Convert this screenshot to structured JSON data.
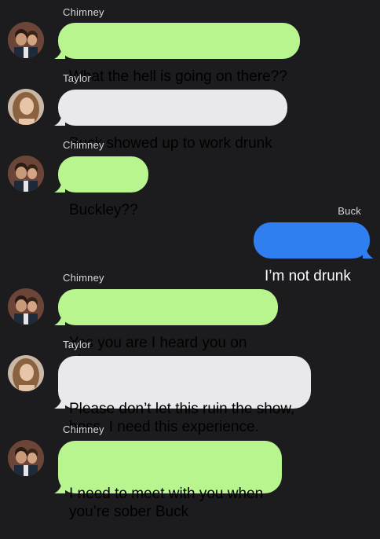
{
  "colors": {
    "background": "#1c1c1e",
    "green_bubble": "#b8f58e",
    "gray_bubble": "#e9e9eb",
    "blue_bubble": "#2f7ff0",
    "sender_name": "#d8d8dc"
  },
  "messages": [
    {
      "sender": "Chimney",
      "text": "What the hell is going on there??",
      "bubble": "green",
      "avatar": "chimney-avatar"
    },
    {
      "sender": "Taylor",
      "text": "Buck showed up to work drunk",
      "bubble": "gray",
      "avatar": "taylor-avatar"
    },
    {
      "sender": "Chimney",
      "text": "Buckley??",
      "bubble": "green",
      "avatar": "chimney-avatar"
    },
    {
      "sender": "Buck",
      "text": "I’m not drunk",
      "bubble": "blue",
      "avatar": null
    },
    {
      "sender": "Chimney",
      "text": "Yes you are I heard you on air",
      "bubble": "green",
      "avatar": "chimney-avatar"
    },
    {
      "sender": "Taylor",
      "text": "Please don’t let this ruin the show,\nboss. I need this experience.",
      "bubble": "gray",
      "avatar": "taylor-avatar"
    },
    {
      "sender": "Chimney",
      "text": "I need to meet with you when\nyou’re sober Buck",
      "bubble": "green",
      "avatar": "chimney-avatar"
    }
  ]
}
